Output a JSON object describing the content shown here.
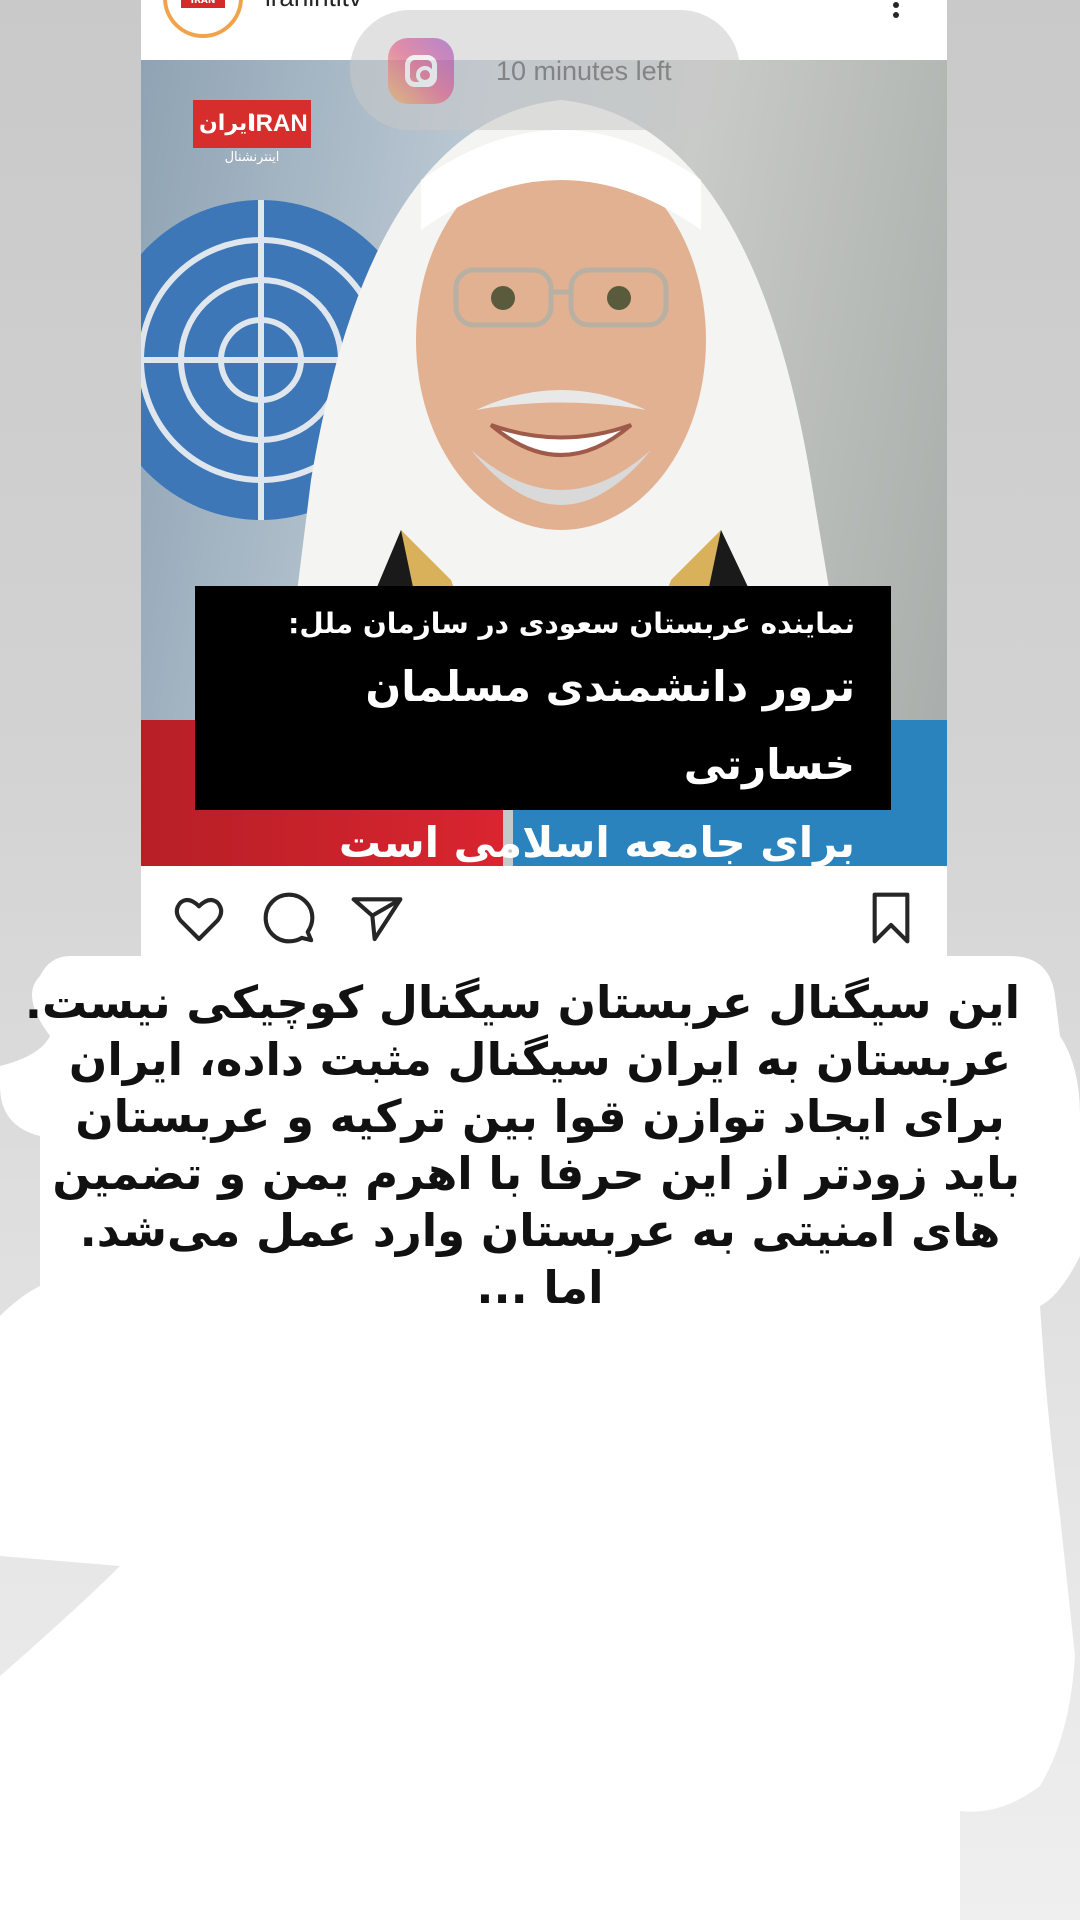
{
  "post": {
    "username": "iranintltv",
    "avatar_logo_text": "IRAN",
    "more_icon": "more-vertical-icon",
    "image": {
      "brand_logo_latin": "IRAN",
      "brand_logo_persian": "ایران",
      "brand_sub": "اینترنشنال",
      "caption_subtitle": "نماینده عربستان سعودی در سازمان ملل:",
      "caption_lines": [
        "ترور دانشمندی مسلمان خسارتی",
        "برای جامعه اسلامی است"
      ]
    },
    "actions": [
      "heart-icon",
      "comment-icon",
      "share-icon",
      "bookmark-icon"
    ]
  },
  "story_overlay": {
    "icon": "instagram-icon",
    "timer_text": "10 minutes left"
  },
  "note": {
    "lines": [
      "این سیگنال عربستان سیگنال کوچیکی نیست.",
      "عربستان به ایران سیگنال مثبت داده، ایران",
      "برای ایجاد توازن قوا بین ترکیه و عربستان",
      "باید زودتر از این حرفا با اهرم یمن و تضمین",
      "های امنیتی به عربستان وارد عمل می‌شد.",
      "اما ..."
    ]
  },
  "colors": {
    "brand_red": "#d62d2d",
    "brand_blue": "#2a83bd",
    "caption_bg": "#000000"
  }
}
